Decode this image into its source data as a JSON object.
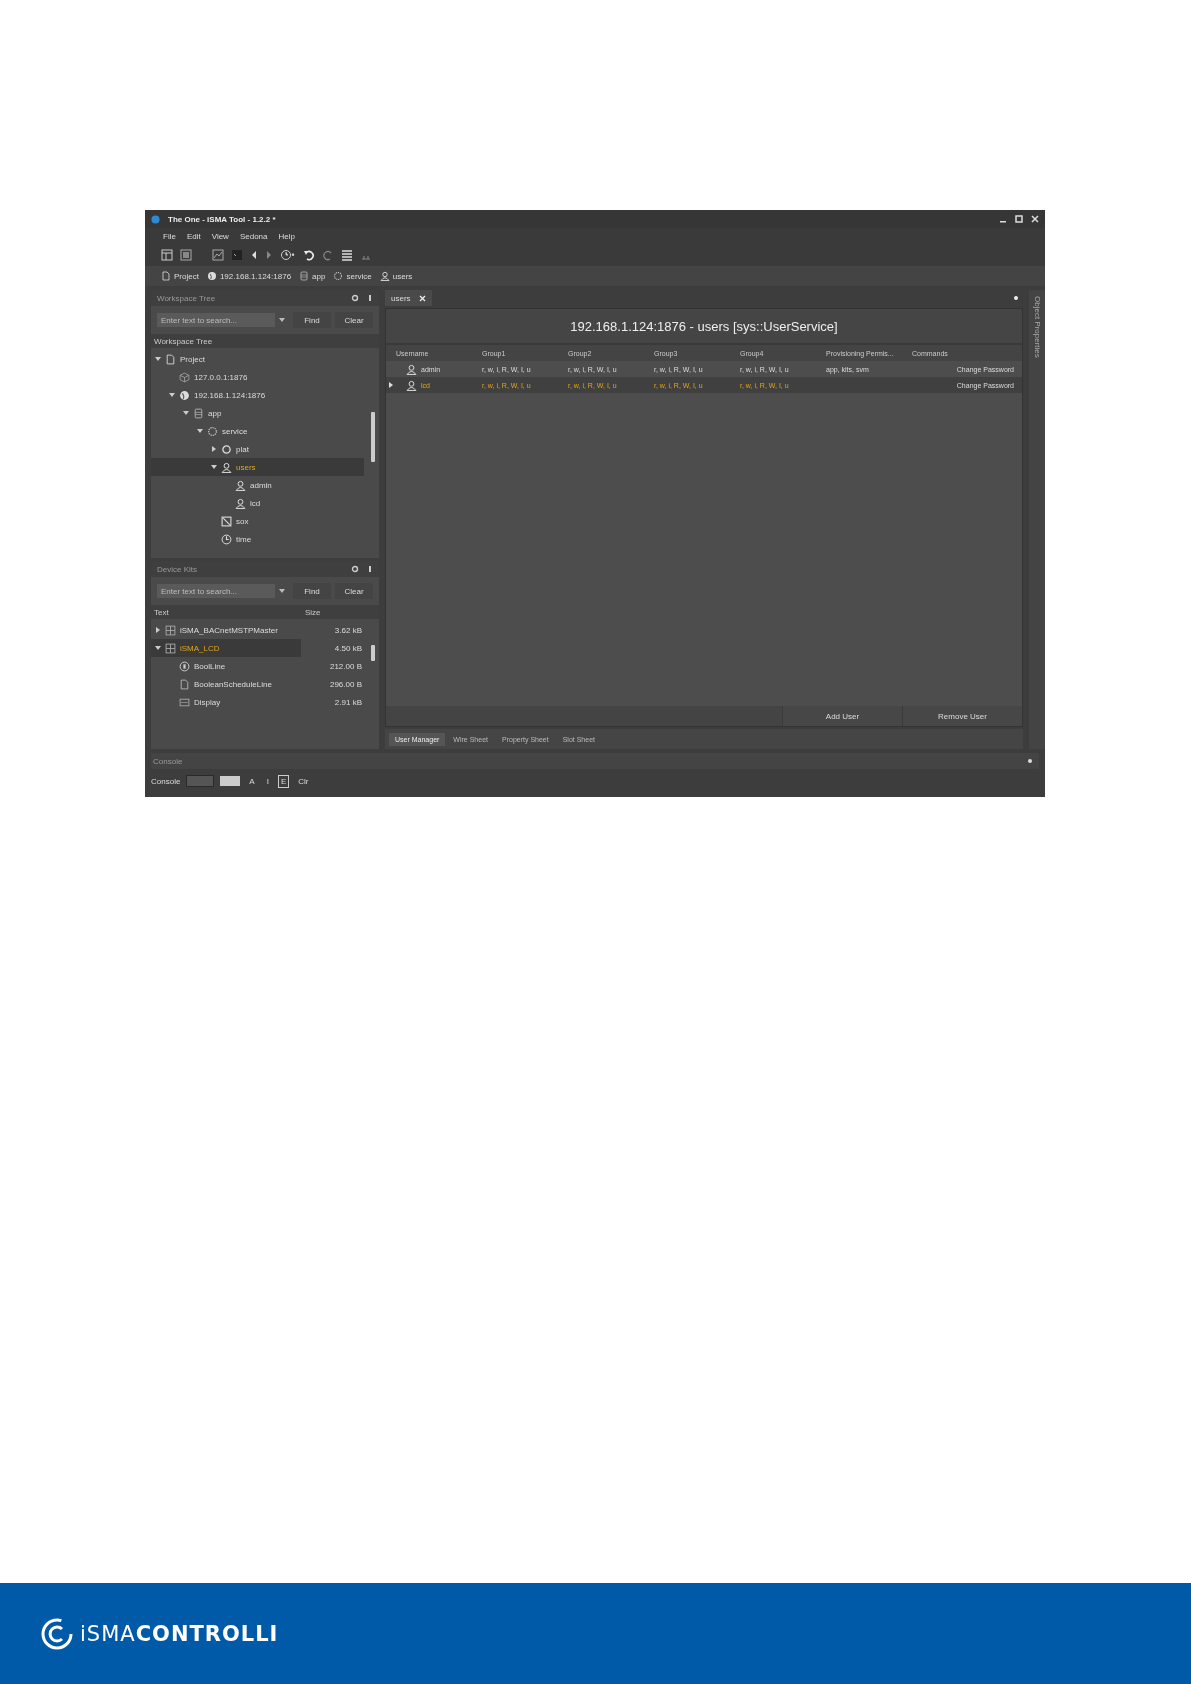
{
  "window": {
    "title": "The One - iSMA Tool - 1.2.2 *"
  },
  "menu": [
    "File",
    "Edit",
    "View",
    "Sedona",
    "Help"
  ],
  "breadcrumb": [
    {
      "label": "Project",
      "kind": "page"
    },
    {
      "label": "192.168.1.124:1876",
      "kind": "globe"
    },
    {
      "label": "app",
      "kind": "db"
    },
    {
      "label": "service",
      "kind": "gear"
    },
    {
      "label": "users",
      "kind": "user"
    }
  ],
  "workspace_panel": {
    "title": "Workspace Tree",
    "search": {
      "placeholder": "Enter text to search..."
    },
    "find": "Find",
    "clear": "Clear",
    "header": "Workspace Tree",
    "tree": [
      {
        "label": "Project",
        "kind": "page",
        "expanded": true,
        "selected": false,
        "children": [
          {
            "label": "127.0.0.1:1876",
            "kind": "server",
            "selected": false
          },
          {
            "label": "192.168.1.124:1876",
            "kind": "globe",
            "expanded": true,
            "selected": false,
            "children": [
              {
                "label": "app",
                "kind": "db",
                "expanded": true,
                "selected": false,
                "children": [
                  {
                    "label": "service",
                    "kind": "gear",
                    "expanded": true,
                    "selected": false,
                    "children": [
                      {
                        "label": "plat",
                        "kind": "cog",
                        "expanded": false,
                        "selected": false
                      },
                      {
                        "label": "users",
                        "kind": "user",
                        "expanded": true,
                        "selected": true,
                        "children": [
                          {
                            "label": "admin",
                            "kind": "user",
                            "selected": false
                          },
                          {
                            "label": "lcd",
                            "kind": "user",
                            "selected": false
                          }
                        ]
                      },
                      {
                        "label": "sox",
                        "kind": "sox",
                        "selected": false
                      },
                      {
                        "label": "time",
                        "kind": "clock",
                        "selected": false
                      }
                    ]
                  }
                ]
              }
            ]
          }
        ]
      }
    ]
  },
  "device_kits": {
    "title": "Device Kits",
    "search": {
      "placeholder": "Enter text to search..."
    },
    "find": "Find",
    "clear": "Clear",
    "columns": [
      "Text",
      "Size"
    ],
    "rows": [
      {
        "name": "iSMA_BACnetMSTPMaster",
        "size": "3.62 kB",
        "kind": "kit",
        "expanded": false,
        "selected": false
      },
      {
        "name": "iSMA_LCD",
        "size": "4.50 kB",
        "kind": "kit",
        "expanded": true,
        "selected": true,
        "children": [
          {
            "name": "BoolLine",
            "size": "212.00 B",
            "kind": "bool",
            "selected": false
          },
          {
            "name": "BooleanScheduleLine",
            "size": "296.00 B",
            "kind": "schedule",
            "selected": false
          },
          {
            "name": "Display",
            "size": "2.91 kB",
            "kind": "display",
            "selected": false
          }
        ]
      }
    ]
  },
  "editor": {
    "tab": "users",
    "heading": "192.168.1.124:1876 - users [sys::UserService]",
    "columns": [
      "Username",
      "Group1",
      "Group2",
      "Group3",
      "Group4",
      "Provisioning Permis...",
      "Commands"
    ],
    "rows": [
      {
        "selected": false,
        "username": "admin",
        "groups": [
          "r, w, i, R, W, I, u",
          "r, w, i, R, W, I, u",
          "r, w, i, R, W, I, u",
          "r, w, i, R, W, I, u"
        ],
        "provisioning": "app, kits, svm",
        "command": "Change Password"
      },
      {
        "selected": true,
        "username": "lcd",
        "groups": [
          "r, w, i, R, W, I, u",
          "r, w, i, R, W, I, u",
          "r, w, i, R, W, I, u",
          "r, w, i, R, W, I, u"
        ],
        "provisioning": "",
        "command": "Change Password"
      }
    ],
    "buttons": [
      "Add User",
      "Remove User"
    ],
    "bottom_tabs": [
      {
        "label": "User Manager",
        "selected": true
      },
      {
        "label": "Wire Sheet",
        "selected": false
      },
      {
        "label": "Property Sheet",
        "selected": false
      },
      {
        "label": "Slot Sheet",
        "selected": false
      }
    ]
  },
  "side_strip": "Object Properties",
  "console": {
    "title": "Console",
    "label": "Console",
    "filters": [
      {
        "label": "A",
        "selected": false
      },
      {
        "label": "I",
        "selected": false
      },
      {
        "label": "E",
        "selected": true
      },
      {
        "label": "Clr",
        "selected": false
      }
    ]
  },
  "footer": {
    "logo": "iSMA**CONTROLLI**"
  }
}
